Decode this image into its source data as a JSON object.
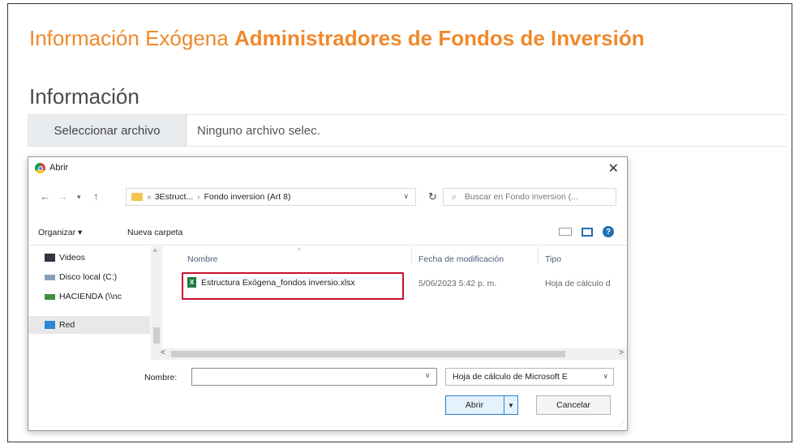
{
  "page": {
    "title_light": "Información Exógena",
    "title_bold": "Administradores de Fondos de Inversión",
    "section_title": "Información",
    "file_button": "Seleccionar archivo",
    "file_status": "Ninguno archivo selec."
  },
  "dialog": {
    "title": "Abrir",
    "close": "✕",
    "address": {
      "prefix": "«",
      "part1": "3Estruct...",
      "separator": "›",
      "part2": "Fondo inversion (Art 8)"
    },
    "search_placeholder": "Buscar en Fondo inversion (...",
    "toolbar": {
      "organize": "Organizar ▾",
      "new_folder": "Nueva carpeta"
    },
    "sidebar": [
      {
        "label": "Videos",
        "icon": "video-folder-icon"
      },
      {
        "label": "Disco local (C:)",
        "icon": "drive-icon"
      },
      {
        "label": "HACIENDA (\\\\nc",
        "icon": "network-drive-icon"
      },
      {
        "label": "Red",
        "icon": "network-icon"
      }
    ],
    "columns": {
      "name": "Nombre",
      "date": "Fecha de modificación",
      "type": "Tipo"
    },
    "file": {
      "name": "Estructura Exógena_fondos inversio.xlsx",
      "date": "5/06/2023 5:42 p. m.",
      "type": "Hoja de cálculo d"
    },
    "name_label": "Nombre:",
    "name_value": "",
    "file_type": "Hoja de cálculo de Microsoft E",
    "open_button": "Abrir",
    "cancel_button": "Cancelar"
  },
  "colors": {
    "title_orange": "#f0892b",
    "highlight_red": "#c8102e",
    "accent_blue": "#1f6fb2"
  }
}
